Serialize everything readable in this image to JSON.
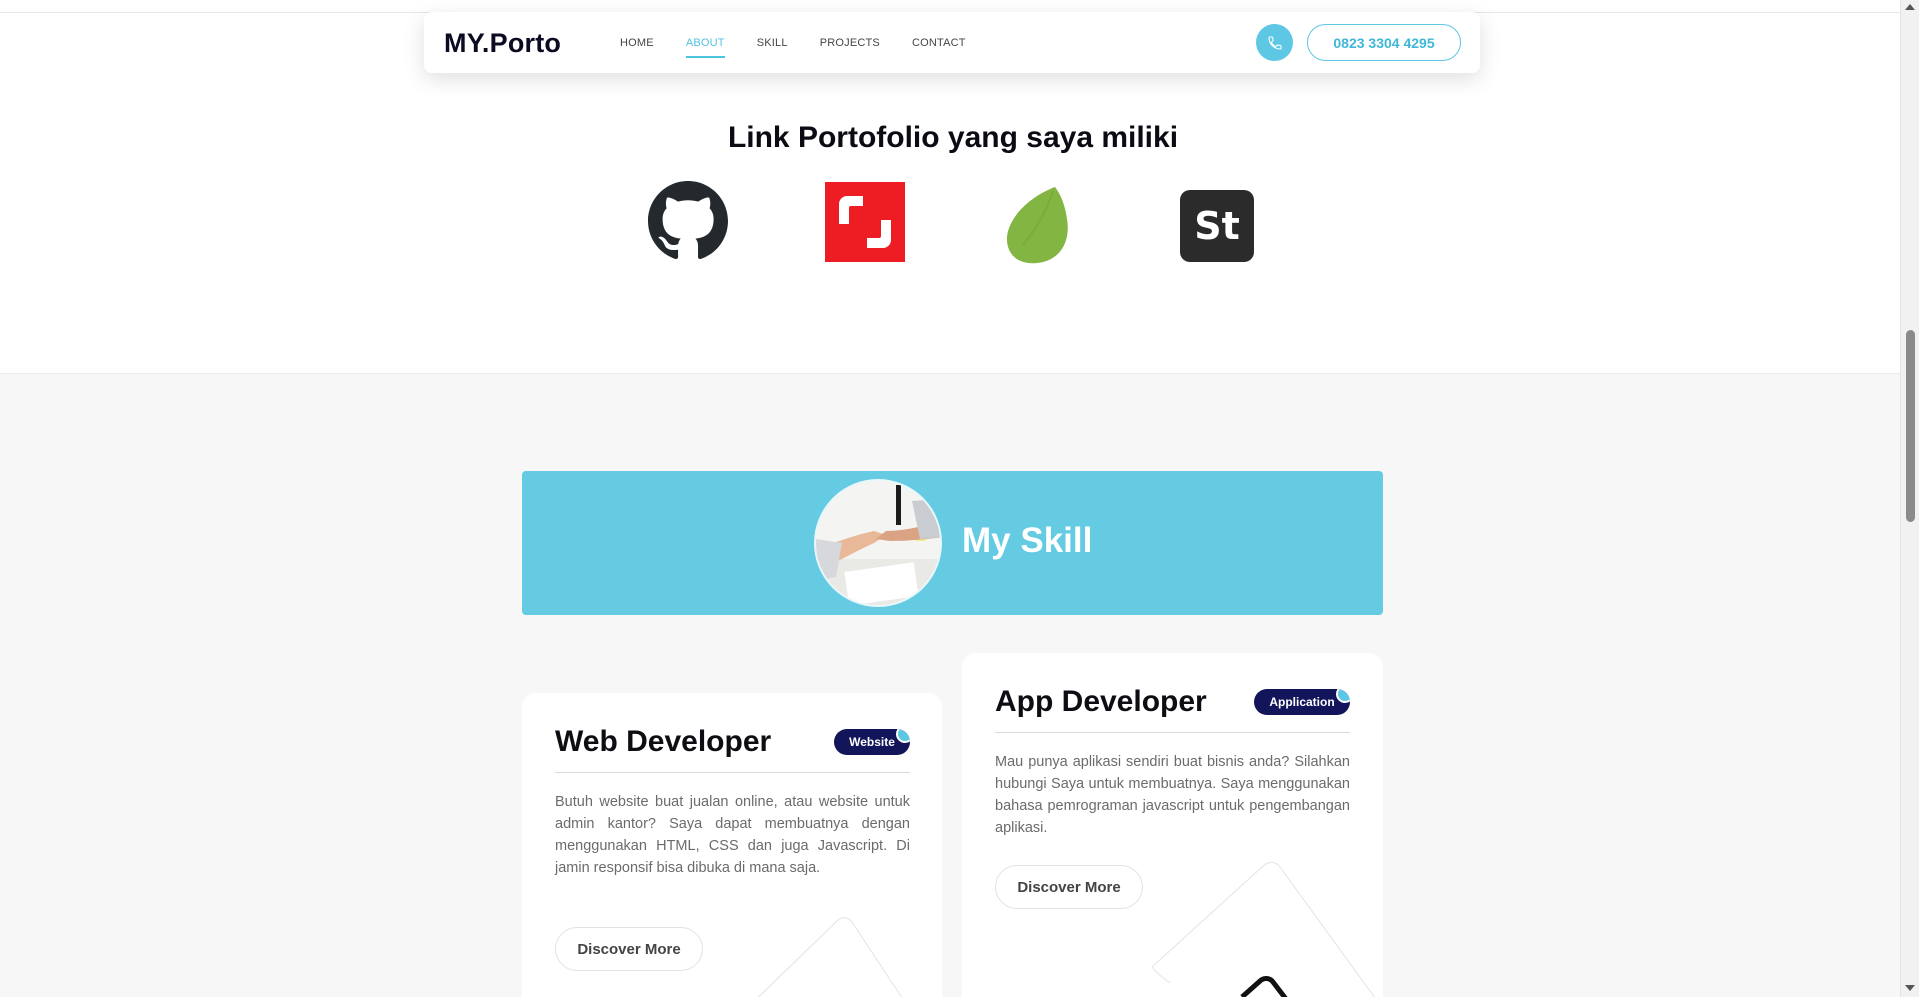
{
  "header": {
    "brand": "MY.Porto",
    "nav": [
      "HOME",
      "ABOUT",
      "SKILL",
      "PROJECTS",
      "CONTACT"
    ],
    "active_nav": "ABOUT",
    "phone": "0823 3304 4295"
  },
  "portfolio": {
    "title": "Link Portofolio yang saya miliki",
    "logos": [
      "github-icon",
      "shutterstock-icon",
      "envato-icon",
      "stockbit-icon"
    ]
  },
  "skill": {
    "banner_title": "My Skill",
    "cards": [
      {
        "title": "Web Developer",
        "badge": "Website",
        "text": "Butuh website buat jualan online, atau website untuk admin kantor? Saya dapat membuatnya dengan menggunakan HTML, CSS dan juga Javascript. Di jamin responsif bisa dibuka di mana saja.",
        "button": "Discover More"
      },
      {
        "title": "App Developer",
        "badge": "Application",
        "text": "Mau punya aplikasi sendiri buat bisnis anda? Silahkan hubungi Saya untuk membuatnya. Saya menggunakan bahasa pemrograman javascript untuk pengembangan aplikasi.",
        "button": "Discover More"
      }
    ]
  },
  "colors": {
    "accent": "#65cbe3",
    "badge": "#13155a",
    "shutterstock": "#ee1d23",
    "envato": "#82b541",
    "dark": "#2b2b2b"
  }
}
